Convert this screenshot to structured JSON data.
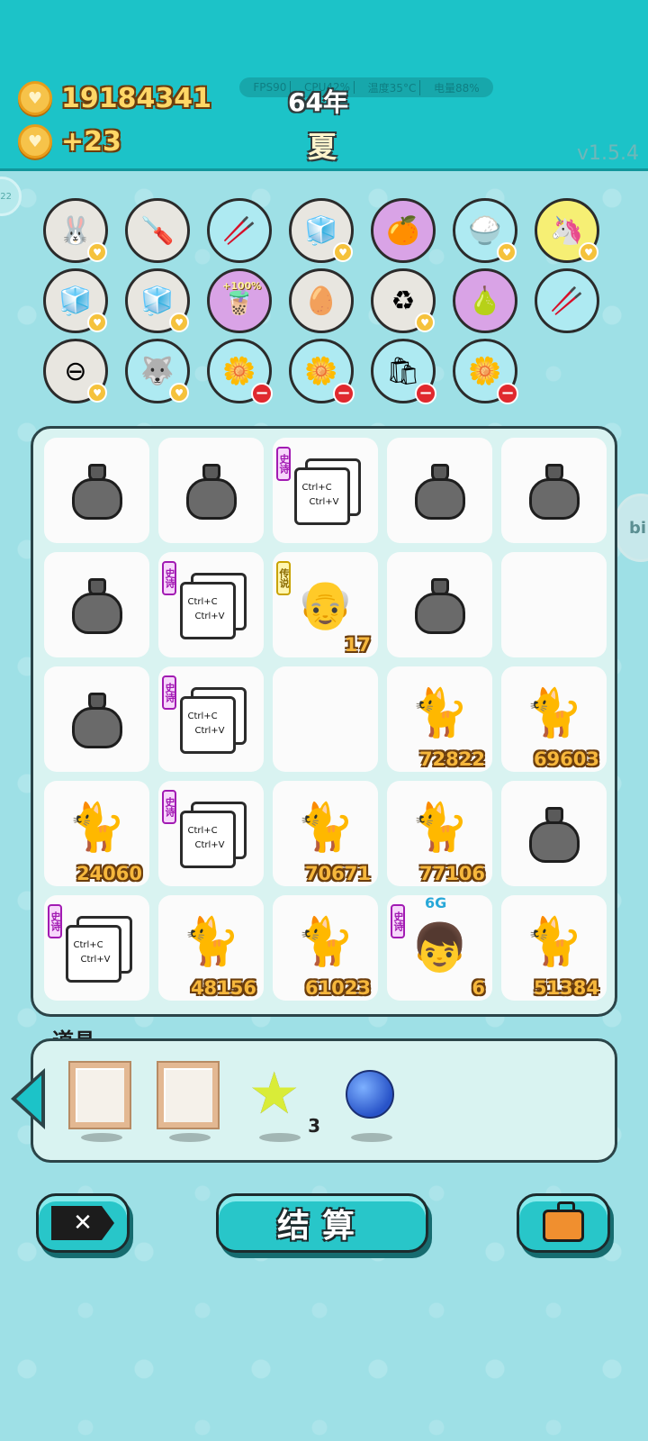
{
  "header": {
    "coins": "19184341",
    "income": "+23",
    "status": [
      "FPS90",
      "CPU42%",
      "温度35°C",
      "电量88%"
    ],
    "year": "64年",
    "season": "夏",
    "version": "v1.5.4",
    "side_badge": "22",
    "right_badge": "bi"
  },
  "collection": [
    {
      "icon": "rabbit-icon",
      "glyph": "🐰",
      "bg": "gray",
      "badge": "heart"
    },
    {
      "icon": "screwdriver-icon",
      "glyph": "🪛",
      "bg": "gray",
      "badge": ""
    },
    {
      "icon": "chopsticks-icon",
      "glyph": "🥢",
      "bg": "blue",
      "badge": ""
    },
    {
      "icon": "sugar-cubes-icon",
      "glyph": "🧊",
      "bg": "gray",
      "badge": "heart"
    },
    {
      "icon": "eyepatch-fruit-icon",
      "glyph": "🍊",
      "bg": "purple",
      "badge": ""
    },
    {
      "icon": "rice-bowl-icon",
      "glyph": "🍚",
      "bg": "blue",
      "badge": "heart"
    },
    {
      "icon": "unicorn-icon",
      "glyph": "🦄",
      "bg": "yellow",
      "badge": "heart"
    },
    {
      "icon": "sugar-cubes-icon",
      "glyph": "🧊",
      "bg": "gray",
      "badge": "heart"
    },
    {
      "icon": "sugar-cubes-icon",
      "glyph": "🧊",
      "bg": "gray",
      "badge": "heart"
    },
    {
      "icon": "boba-tea-icon",
      "glyph": "🧋",
      "bg": "purple",
      "badge": "",
      "label": "+100%"
    },
    {
      "icon": "egg-tray-icon",
      "glyph": "🥚",
      "bg": "gray",
      "badge": ""
    },
    {
      "icon": "recycle-icon",
      "glyph": "♻",
      "bg": "gray",
      "badge": "heart"
    },
    {
      "icon": "pomelo-icon",
      "glyph": "🍐",
      "bg": "purple",
      "badge": ""
    },
    {
      "icon": "chopsticks-icon",
      "glyph": "🥢",
      "bg": "blue",
      "badge": ""
    },
    {
      "icon": "no-entry-icon",
      "glyph": "⊖",
      "bg": "gray",
      "badge": "heart"
    },
    {
      "icon": "husky-dog-icon",
      "glyph": "🐺",
      "bg": "blue",
      "badge": "heart"
    },
    {
      "icon": "potted-flower-icon",
      "glyph": "🌼",
      "bg": "blue",
      "badge": "minus"
    },
    {
      "icon": "potted-flower-icon",
      "glyph": "🌼",
      "bg": "blue",
      "badge": "minus"
    },
    {
      "icon": "seed-bag-icon",
      "glyph": "🛍",
      "bg": "blue",
      "badge": "minus"
    },
    {
      "icon": "potted-flower-icon",
      "glyph": "🌼",
      "bg": "blue",
      "badge": "minus"
    }
  ],
  "board": [
    {
      "type": "bag"
    },
    {
      "type": "bag"
    },
    {
      "type": "copy",
      "tag": "史诗"
    },
    {
      "type": "bag"
    },
    {
      "type": "bag"
    },
    {
      "type": "bag"
    },
    {
      "type": "copy",
      "tag": "史诗"
    },
    {
      "type": "face",
      "tag": "传说",
      "glyph": "👴",
      "num": "17"
    },
    {
      "type": "bag"
    },
    {
      "type": "empty"
    },
    {
      "type": "bag"
    },
    {
      "type": "copy",
      "tag": "史诗"
    },
    {
      "type": "empty"
    },
    {
      "type": "cat",
      "num": "72822"
    },
    {
      "type": "cat",
      "num": "69603"
    },
    {
      "type": "cat",
      "num": "24060"
    },
    {
      "type": "copy",
      "tag": "史诗"
    },
    {
      "type": "cat",
      "num": "70671"
    },
    {
      "type": "cat",
      "num": "77106"
    },
    {
      "type": "bag"
    },
    {
      "type": "copy",
      "tag": "史诗"
    },
    {
      "type": "cat",
      "num": "48156"
    },
    {
      "type": "cat",
      "num": "61023"
    },
    {
      "type": "face",
      "tag": "史诗",
      "glyph": "👦",
      "num": "6",
      "top": "6G"
    },
    {
      "type": "cat",
      "num": "51384"
    }
  ],
  "copy_card": {
    "line1": "Ctrl+C",
    "line2": "Ctrl+V"
  },
  "items": {
    "title": "道具",
    "star_count": "3"
  },
  "buttons": {
    "exit": "✕",
    "settle": "结算"
  },
  "colors": {
    "header_bg": "#1cc3c8",
    "page_bg": "#9ee0e6",
    "coin_text": "#ffd766",
    "number_text": "#f6b73c",
    "epic_tag": "#a21bb3",
    "legend_tag": "#c9a300"
  }
}
